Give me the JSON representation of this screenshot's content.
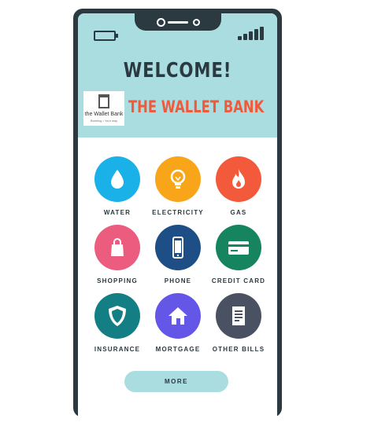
{
  "header": {
    "welcome": "WELCOME!",
    "bank_name": "THE WALLET BANK",
    "logo": {
      "text": "the Wallet Bank",
      "subtext": "Banking • Your way"
    }
  },
  "status_bar": {
    "battery_icon": "battery-icon",
    "signal_icon": "signal-bars-icon"
  },
  "services": [
    {
      "label": "WATER",
      "icon": "water-drop-icon",
      "color": "#1ab1e8"
    },
    {
      "label": "ELECTRICITY",
      "icon": "light-bulb-icon",
      "color": "#f9a51a"
    },
    {
      "label": "GAS",
      "icon": "flame-icon",
      "color": "#f25a3b"
    },
    {
      "label": "SHOPPING",
      "icon": "shopping-bag-icon",
      "color": "#ec5c7e"
    },
    {
      "label": "PHONE",
      "icon": "mobile-phone-icon",
      "color": "#1d4f86"
    },
    {
      "label": "CREDIT CARD",
      "icon": "credit-card-icon",
      "color": "#15845f"
    },
    {
      "label": "INSURANCE",
      "icon": "shield-icon",
      "color": "#137f84"
    },
    {
      "label": "MORTGAGE",
      "icon": "house-icon",
      "color": "#6457e8"
    },
    {
      "label": "OTHER BILLS",
      "icon": "document-icon",
      "color": "#4a5163"
    }
  ],
  "more_button": {
    "label": "MORE"
  },
  "colors": {
    "header_bg": "#a9dde0",
    "frame": "#2b3a41",
    "accent": "#f05a3c"
  }
}
